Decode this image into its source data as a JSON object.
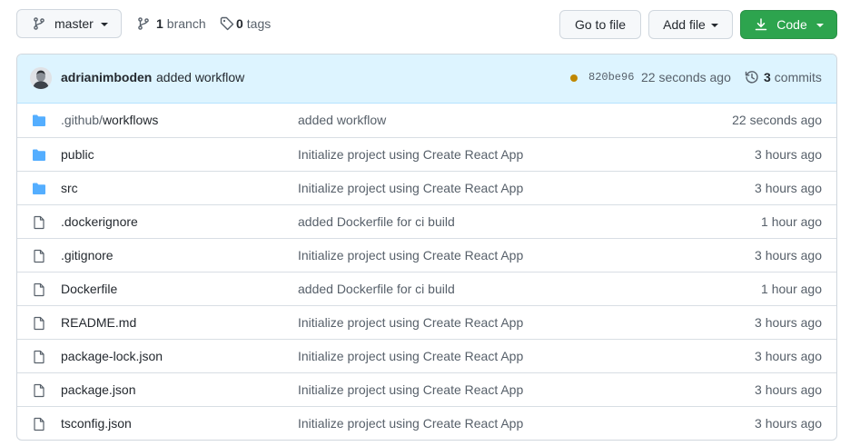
{
  "toolbar": {
    "branch_selector": "master",
    "branches_count": "1",
    "branches_label": "branch",
    "tags_count": "0",
    "tags_label": "tags",
    "go_to_file": "Go to file",
    "add_file": "Add file",
    "code": "Code"
  },
  "latest_commit": {
    "author": "adrianimboden",
    "message": "added workflow",
    "status": "pending",
    "status_color": "#bf8700",
    "sha": "820be96",
    "time": "22 seconds ago",
    "commits_count": "3",
    "commits_label": "commits"
  },
  "files": [
    {
      "type": "directory",
      "prefix": ".github/",
      "name": "workflows",
      "commit": "added workflow",
      "time": "22 seconds ago"
    },
    {
      "type": "directory",
      "prefix": "",
      "name": "public",
      "commit": "Initialize project using Create React App",
      "time": "3 hours ago"
    },
    {
      "type": "directory",
      "prefix": "",
      "name": "src",
      "commit": "Initialize project using Create React App",
      "time": "3 hours ago"
    },
    {
      "type": "file",
      "prefix": "",
      "name": ".dockerignore",
      "commit": "added Dockerfile for ci build",
      "time": "1 hour ago"
    },
    {
      "type": "file",
      "prefix": "",
      "name": ".gitignore",
      "commit": "Initialize project using Create React App",
      "time": "3 hours ago"
    },
    {
      "type": "file",
      "prefix": "",
      "name": "Dockerfile",
      "commit": "added Dockerfile for ci build",
      "time": "1 hour ago"
    },
    {
      "type": "file",
      "prefix": "",
      "name": "README.md",
      "commit": "Initialize project using Create React App",
      "time": "3 hours ago"
    },
    {
      "type": "file",
      "prefix": "",
      "name": "package-lock.json",
      "commit": "Initialize project using Create React App",
      "time": "3 hours ago"
    },
    {
      "type": "file",
      "prefix": "",
      "name": "package.json",
      "commit": "Initialize project using Create React App",
      "time": "3 hours ago"
    },
    {
      "type": "file",
      "prefix": "",
      "name": "tsconfig.json",
      "commit": "Initialize project using Create React App",
      "time": "3 hours ago"
    }
  ],
  "colors": {
    "folder": "#54aeff",
    "primary_button": "#2da44e",
    "header_background": "#ddf4ff"
  }
}
